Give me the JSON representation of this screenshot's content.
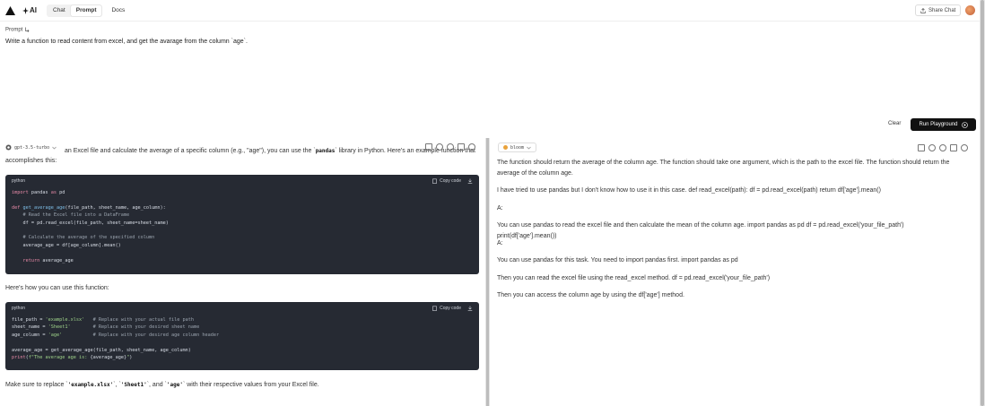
{
  "header": {
    "brand": "AI",
    "tabs": [
      {
        "label": "Chat"
      },
      {
        "label": "Prompt"
      }
    ],
    "docs": "Docs",
    "share": "Share Chat"
  },
  "prompt": {
    "label": "Prompt",
    "text": "Write a function to read content from excel, and get the avarage from the column `age`."
  },
  "actions": {
    "clear": "Clear",
    "run": "Run Playground"
  },
  "left": {
    "model": "gpt-3.5-turbo",
    "intro_line1_pre": "an Excel file and calculate the average of a specific column (e.g., \"age\"), you can use the `",
    "intro_code": "pandas",
    "intro_line1_post": "` library in Python. Here's an example function that",
    "intro_line2": "accomplishes this:",
    "code1": {
      "lang": "python",
      "copy": "Copy code"
    },
    "how_to": "Here's how you can use this function:",
    "code2": {
      "lang": "python",
      "copy": "Copy code"
    },
    "outro_pre": "Make sure to replace `",
    "outro_c1": "'example.xlsx'",
    "outro_mid1": "`, `",
    "outro_c2": "'Sheet1'",
    "outro_mid2": "`, and `",
    "outro_c3": "'age'",
    "outro_post": "` with their respective values from your Excel file."
  },
  "right": {
    "model": "bloom",
    "paragraphs": [
      "The function should return the average of the column age. The function should take one argument, which is the path to the excel file. The function should return the average of the column age.",
      "I have tried to use pandas but I don't know how to use it in this case. def read_excel(path): df = pd.read_excel(path) return df['age'].mean()",
      "A:",
      "You can use pandas to read the excel file and then calculate the mean of the column age. import pandas as pd df = pd.read_excel('your_file_path') print(df['age'].mean())",
      "A:",
      "You can use pandas for this task. You need to import pandas first. import pandas as pd",
      "Then you can read the excel file using the read_excel method. df = pd.read_excel('your_file_path')",
      "Then you can access the column age by using the df['age'] method."
    ]
  }
}
